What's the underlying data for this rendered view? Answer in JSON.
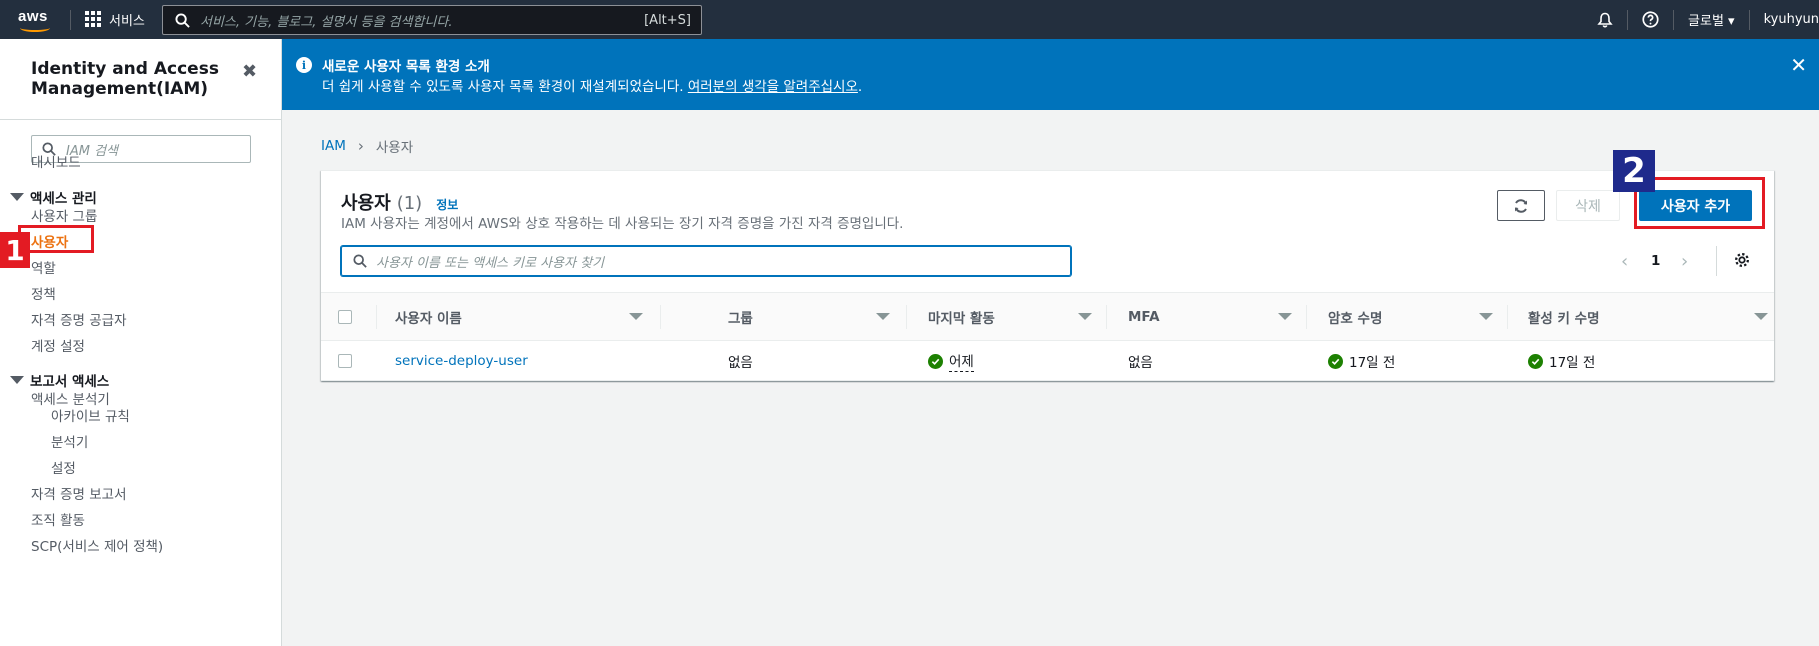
{
  "topnav": {
    "logo": "aws",
    "services_label": "서비스",
    "search_placeholder": "서비스, 기능, 블로그, 설명서 등을 검색합니다.",
    "search_shortcut": "[Alt+S]",
    "region_label": "글로벌 ▾",
    "account_label": "kyuhyun"
  },
  "sidebar": {
    "title": "Identity and Access Management(IAM)",
    "search_placeholder": "IAM 검색",
    "dashboard": "대시보드",
    "section_access": "액세스 관리",
    "access_items": [
      "사용자 그룹",
      "사용자",
      "역할",
      "정책",
      "자격 증명 공급자",
      "계정 설정"
    ],
    "section_reports": "보고서 액세스",
    "reports_analyzer": "액세스 분석기",
    "analyzer_items": [
      "아카이브 규칙",
      "분석기",
      "설정"
    ],
    "report_items": [
      "자격 증명 보고서",
      "조직 활동",
      "SCP(서비스 제어 정책)"
    ]
  },
  "annotations": {
    "badge_1": "1",
    "badge_2": "2",
    "highlight_color": "#e31b23"
  },
  "flash": {
    "title": "새로운 사용자 목록 환경 소개",
    "body": "더 쉽게 사용할 수 있도록 사용자 목록 환경이 재설계되었습니다. ",
    "link": "여러분의 생각을 알려주십시오",
    "suffix": "."
  },
  "breadcrumb": {
    "root": "IAM",
    "current": "사용자"
  },
  "panel": {
    "title": "사용자",
    "count": "(1)",
    "info": "정보",
    "description": "IAM 사용자는 계정에서 AWS와 상호 작용하는 데 사용되는 장기 자격 증명을 가진 자격 증명입니다.",
    "delete_label": "삭제",
    "add_label": "사용자 추가",
    "search_placeholder": "사용자 이름 또는 액세스 키로 사용자 찾기",
    "page": "1"
  },
  "table": {
    "columns": [
      "사용자 이름",
      "그룹",
      "마지막 활동",
      "MFA",
      "암호 수명",
      "활성 키 수명"
    ],
    "rows": [
      {
        "user_name": "service-deploy-user",
        "group": "없음",
        "last_activity": "어제",
        "mfa": "없음",
        "password_age": "17일 전",
        "active_key_age": "17일 전"
      }
    ]
  },
  "colors": {
    "nav_bg": "#232f3e",
    "accent": "#0073bb",
    "active_nav": "#ec7211",
    "success": "#1d8102"
  }
}
